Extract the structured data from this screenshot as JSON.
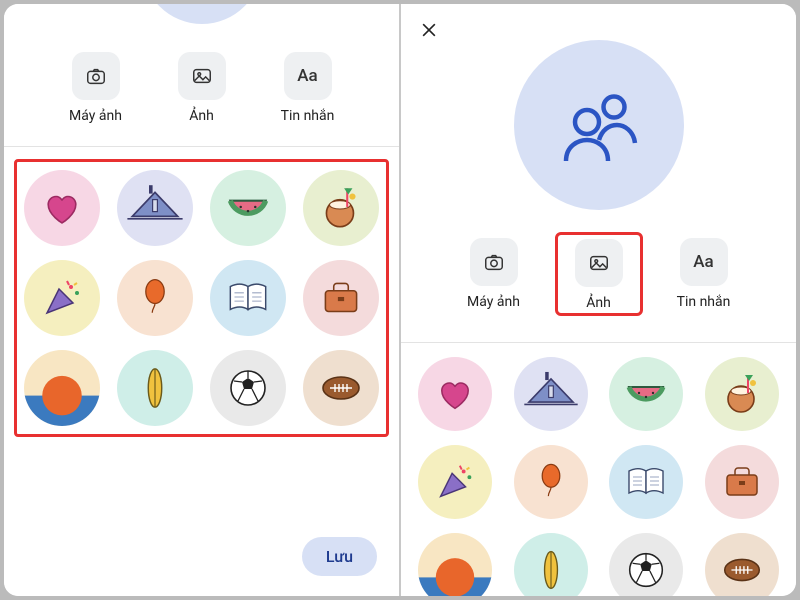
{
  "left": {
    "actions": {
      "camera": "Máy ảnh",
      "photo": "Ảnh",
      "text": "Tin nhắn",
      "text_glyph": "Aa"
    },
    "save": "Lưu",
    "covers": [
      "heart",
      "house",
      "watermelon",
      "coconut",
      "confetti",
      "balloon",
      "book",
      "briefcase",
      "sunset",
      "surfboard",
      "soccer",
      "football"
    ]
  },
  "right": {
    "actions": {
      "camera": "Máy ảnh",
      "photo": "Ảnh",
      "text": "Tin nhắn",
      "text_glyph": "Aa"
    },
    "covers": [
      "heart",
      "house",
      "watermelon",
      "coconut",
      "confetti",
      "balloon",
      "book",
      "briefcase",
      "sunset",
      "surfboard",
      "soccer",
      "football"
    ]
  }
}
